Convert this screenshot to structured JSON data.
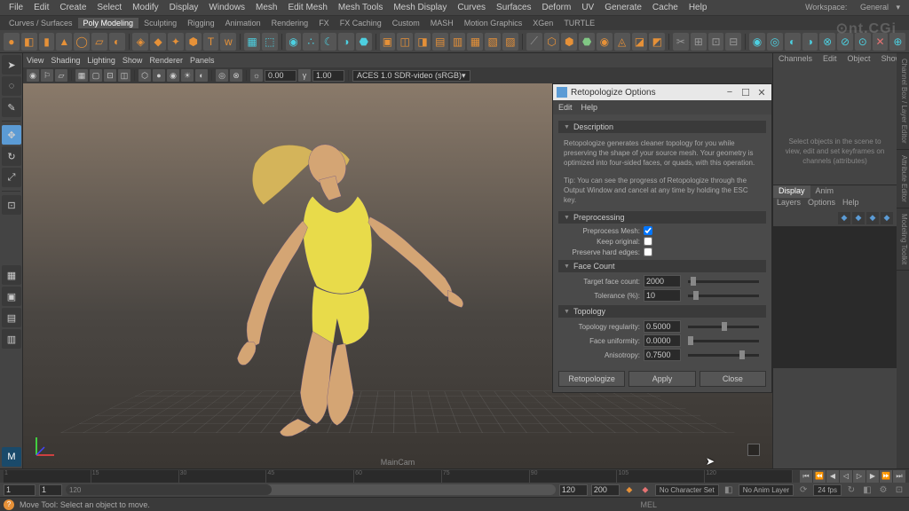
{
  "menubar": [
    "File",
    "Edit",
    "Create",
    "Select",
    "Modify",
    "Display",
    "Windows",
    "Mesh",
    "Edit Mesh",
    "Mesh Tools",
    "Mesh Display",
    "Curves",
    "Surfaces",
    "Deform",
    "UV",
    "Generate",
    "Cache",
    "Help"
  ],
  "workspace": {
    "label": "Workspace:",
    "value": "General"
  },
  "shelf_tabs": [
    "Curves / Surfaces",
    "Poly Modeling",
    "Sculpting",
    "Rigging",
    "Animation",
    "Rendering",
    "FX",
    "FX Caching",
    "Custom",
    "MASH",
    "Motion Graphics",
    "XGen",
    "TURTLE"
  ],
  "shelf_active": "Poly Modeling",
  "view_menus": [
    "View",
    "Shading",
    "Lighting",
    "Show",
    "Renderer",
    "Panels"
  ],
  "view_toolbar": {
    "time": "0.00",
    "fps": "1.00",
    "colorspace": "ACES 1.0 SDR-video (sRGB)"
  },
  "camera": "MainCam",
  "dialog": {
    "title": "Retopologize Options",
    "menus": [
      "Edit",
      "Help"
    ],
    "sections": {
      "description": {
        "label": "Description",
        "text": "Retopologize generates cleaner topology for you while preserving the shape of your source mesh. Your geometry is optimized into four-sided faces, or quads, with this operation.",
        "tip": "Tip: You can see the progress of Retopologize through the Output Window and cancel at any time by holding the ESC key."
      },
      "preprocessing": {
        "label": "Preprocessing",
        "preprocess_mesh": {
          "label": "Preprocess Mesh:",
          "checked": true
        },
        "keep_original": {
          "label": "Keep original:",
          "checked": false
        },
        "preserve_hard": {
          "label": "Preserve hard edges:",
          "checked": false
        }
      },
      "face_count": {
        "label": "Face Count",
        "target": {
          "label": "Target face count:",
          "value": "2000"
        },
        "tolerance": {
          "label": "Tolerance (%):",
          "value": "10"
        }
      },
      "topology": {
        "label": "Topology",
        "regularity": {
          "label": "Topology regularity:",
          "value": "0.5000"
        },
        "uniformity": {
          "label": "Face uniformity:",
          "value": "0.0000"
        },
        "anisotropy": {
          "label": "Anisotropy:",
          "value": "0.7500"
        }
      }
    },
    "buttons": {
      "apply_close": "Retopologize",
      "apply": "Apply",
      "close": "Close"
    }
  },
  "right_panel": {
    "tabs": [
      "Channels",
      "Edit",
      "Object",
      "Show"
    ],
    "hint": "Select objects in the scene to view, edit and set keyframes on channels (attributes)",
    "layer_tabs": [
      "Display",
      "Anim"
    ],
    "layer_menus": [
      "Layers",
      "Options",
      "Help"
    ]
  },
  "side_tabs": [
    "Channel Box / Layer Editor",
    "Attribute Editor",
    "Modeling Toolkit"
  ],
  "timeline": {
    "start": "1",
    "end": "200",
    "range_start": "1",
    "range_mid": "120",
    "range_end_vis": "120",
    "range_end": "200"
  },
  "range_controls": {
    "char": "No Character Set",
    "anim_layer": "No Anim Layer",
    "fps": "24 fps"
  },
  "status": {
    "text": "Move Tool: Select an object to move.",
    "mel": "MEL"
  },
  "watermark": "⊙nt.CGi"
}
